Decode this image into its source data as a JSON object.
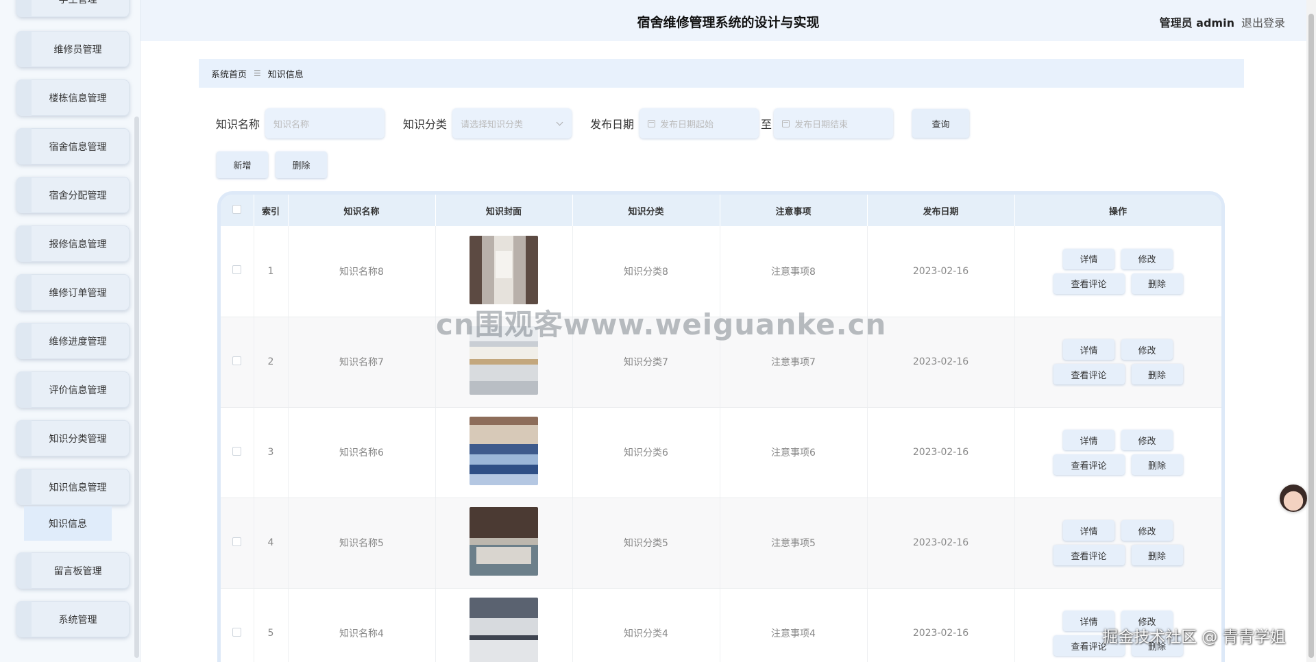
{
  "header": {
    "title": "宿舍维修管理系统的设计与实现",
    "role": "管理员 admin",
    "logout": "退出登录"
  },
  "sidebar": {
    "items": [
      {
        "label": "学生管理"
      },
      {
        "label": "维修员管理"
      },
      {
        "label": "楼栋信息管理"
      },
      {
        "label": "宿舍信息管理"
      },
      {
        "label": "宿舍分配管理"
      },
      {
        "label": "报修信息管理"
      },
      {
        "label": "维修订单管理"
      },
      {
        "label": "维修进度管理"
      },
      {
        "label": "评价信息管理"
      },
      {
        "label": "知识分类管理"
      },
      {
        "label": "知识信息管理"
      },
      {
        "label": "留言板管理"
      },
      {
        "label": "系统管理"
      }
    ],
    "active_sub": "知识信息"
  },
  "breadcrumb": {
    "home": "系统首页",
    "current": "知识信息"
  },
  "search": {
    "name_label": "知识名称",
    "name_placeholder": "知识名称",
    "category_label": "知识分类",
    "category_placeholder": "请选择知识分类",
    "date_label": "发布日期",
    "date_start_placeholder": "发布日期起始",
    "date_to": "至",
    "date_end_placeholder": "发布日期结束",
    "query_button": "查询"
  },
  "actions": {
    "add": "新增",
    "delete": "删除"
  },
  "table": {
    "columns": [
      "索引",
      "知识名称",
      "知识封面",
      "知识分类",
      "注意事项",
      "发布日期",
      "操作"
    ],
    "rows": [
      {
        "index": "1",
        "name": "知识名称8",
        "category": "知识分类8",
        "notes": "注意事项8",
        "date": "2023-02-16"
      },
      {
        "index": "2",
        "name": "知识名称7",
        "category": "知识分类7",
        "notes": "注意事项7",
        "date": "2023-02-16"
      },
      {
        "index": "3",
        "name": "知识名称6",
        "category": "知识分类6",
        "notes": "注意事项6",
        "date": "2023-02-16"
      },
      {
        "index": "4",
        "name": "知识名称5",
        "category": "知识分类5",
        "notes": "注意事项5",
        "date": "2023-02-16"
      },
      {
        "index": "5",
        "name": "知识名称4",
        "category": "知识分类4",
        "notes": "注意事项4",
        "date": "2023-02-16"
      }
    ],
    "row_actions": {
      "detail": "详情",
      "edit": "修改",
      "comments": "查看评论",
      "delete": "删除"
    }
  },
  "watermarks": {
    "center": "cn围观客www.weiguanke.cn",
    "corner": "掘金技术社区 @ 青青学姐"
  }
}
